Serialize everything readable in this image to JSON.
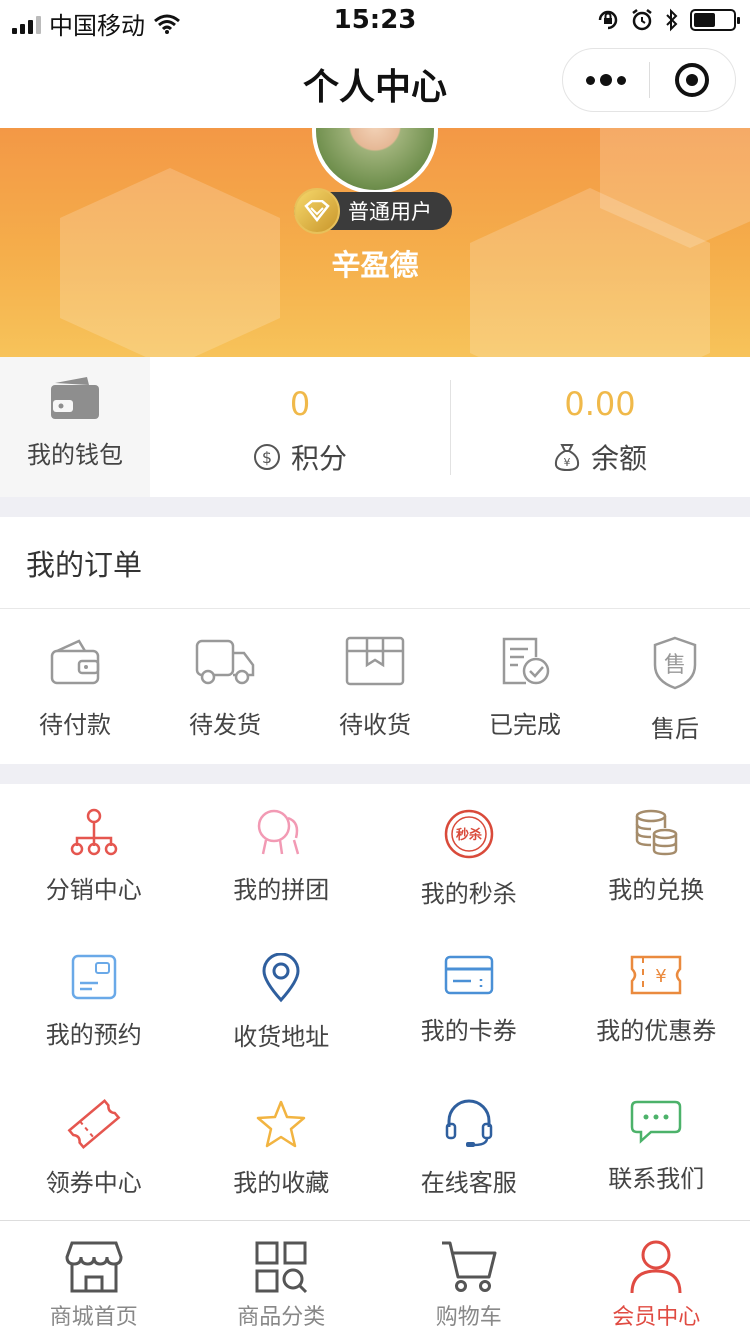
{
  "status_bar": {
    "carrier": "中国移动",
    "time": "15:23"
  },
  "nav": {
    "title": "个人中心"
  },
  "profile": {
    "level_badge": "普通用户",
    "username": "辛盈德"
  },
  "wallet": {
    "label": "我的钱包"
  },
  "stats": [
    {
      "value": "0",
      "label": "积分",
      "icon": "dollar-circle-icon"
    },
    {
      "value": "0.00",
      "label": "余额",
      "icon": "money-bag-icon"
    }
  ],
  "orders": {
    "title": "我的订单",
    "items": [
      {
        "label": "待付款",
        "icon": "wallet-icon"
      },
      {
        "label": "待发货",
        "icon": "truck-icon"
      },
      {
        "label": "待收货",
        "icon": "package-icon"
      },
      {
        "label": "已完成",
        "icon": "checklist-icon"
      },
      {
        "label": "售后",
        "icon": "shield-icon"
      }
    ]
  },
  "services": [
    {
      "label": "分销中心",
      "icon": "network-icon",
      "color": "#e5564f"
    },
    {
      "label": "我的拼团",
      "icon": "group-icon",
      "color": "#f29ab4"
    },
    {
      "label": "我的秒杀",
      "icon": "flash-sale-icon",
      "color": "#d94a3a",
      "icon_text": "秒杀"
    },
    {
      "label": "我的兑换",
      "icon": "coins-icon",
      "color": "#a58c6b"
    },
    {
      "label": "我的预约",
      "icon": "card-icon",
      "color": "#6aa9e8"
    },
    {
      "label": "收货地址",
      "icon": "location-icon",
      "color": "#2f5f9e"
    },
    {
      "label": "我的卡券",
      "icon": "ticket-card-icon",
      "color": "#4a90d6"
    },
    {
      "label": "我的优惠券",
      "icon": "coupon-icon",
      "color": "#ea8a3e",
      "icon_text": "¥"
    },
    {
      "label": "领券中心",
      "icon": "voucher-icon",
      "color": "#e5564f"
    },
    {
      "label": "我的收藏",
      "icon": "star-icon",
      "color": "#f2b441"
    },
    {
      "label": "在线客服",
      "icon": "headset-icon",
      "color": "#2f5f9e"
    },
    {
      "label": "联系我们",
      "icon": "chat-icon",
      "color": "#4cb26a"
    }
  ],
  "tabbar": [
    {
      "label": "商城首页",
      "icon": "shop-icon",
      "active": false
    },
    {
      "label": "商品分类",
      "icon": "category-icon",
      "active": false
    },
    {
      "label": "购物车",
      "icon": "cart-icon",
      "active": false
    },
    {
      "label": "会员中心",
      "icon": "user-icon",
      "active": true
    }
  ],
  "colors": {
    "accent": "#e04b42",
    "value_gold": "#f0b94a",
    "hero_top": "#f39846",
    "hero_bottom": "#f7c35a"
  }
}
